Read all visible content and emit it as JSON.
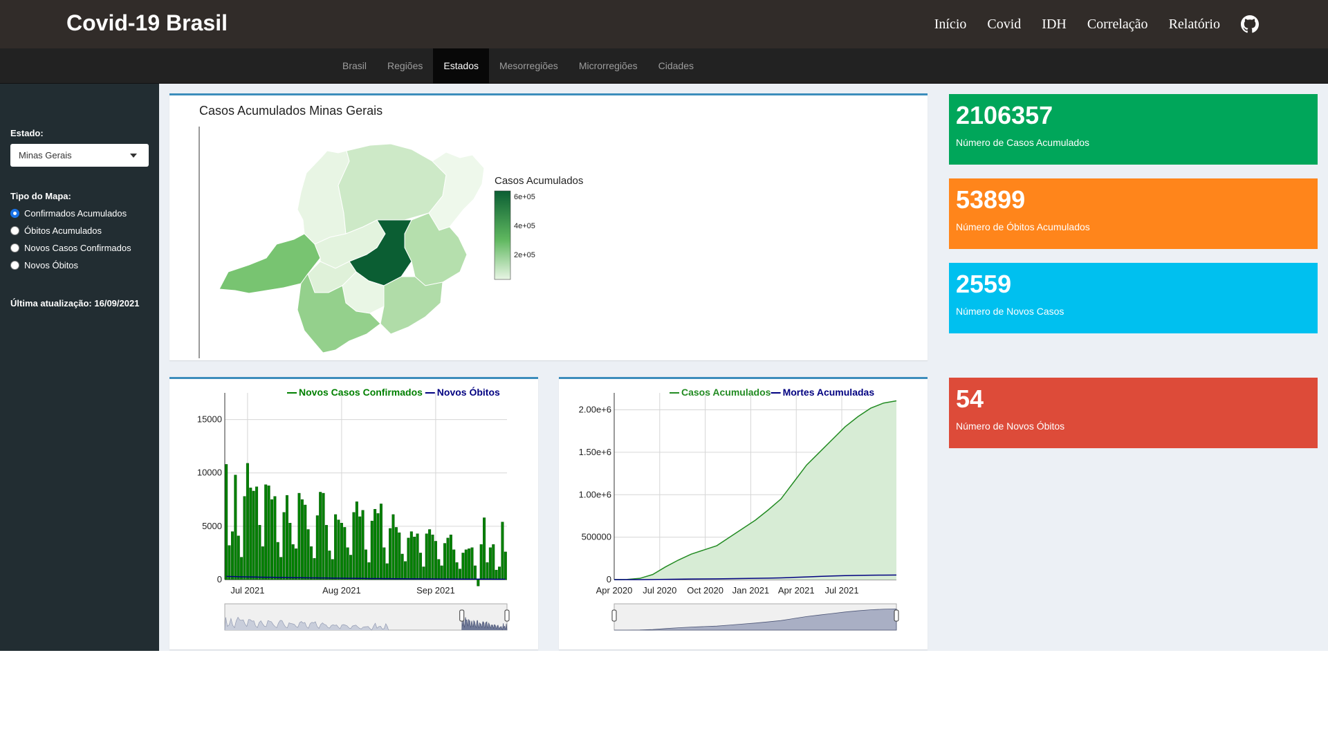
{
  "header": {
    "title": "Covid-19 Brasil",
    "nav": [
      "Início",
      "Covid",
      "IDH",
      "Correlação",
      "Relatório"
    ]
  },
  "subnav": {
    "tabs": [
      "Brasil",
      "Regiões",
      "Estados",
      "Mesorregiões",
      "Microrregiões",
      "Cidades"
    ],
    "active": "Estados"
  },
  "sidebar": {
    "estado_label": "Estado:",
    "estado_value": "Minas Gerais",
    "tipo_label": "Tipo do Mapa:",
    "options": [
      "Confirmados Acumulados",
      "Óbitos Acumulados",
      "Novos Casos Confirmados",
      "Novos Óbitos"
    ],
    "selected": "Confirmados Acumulados",
    "update": "Última atualização: 16/09/2021"
  },
  "map": {
    "title": "Casos Acumulados Minas Gerais",
    "legend_title": "Casos Acumulados",
    "legend_ticks": [
      "6e+05",
      "4e+05",
      "2e+05"
    ]
  },
  "value_boxes": [
    {
      "value": "2106357",
      "label": "Número de Casos Acumulados",
      "color": "#00a65a"
    },
    {
      "value": "53899",
      "label": "Número de Óbitos Acumulados",
      "color": "#ff851b"
    },
    {
      "value": "2559",
      "label": "Número de Novos Casos",
      "color": "#00c0ef"
    },
    {
      "value": "54",
      "label": "Número de Novos Óbitos",
      "color": "#dd4b39"
    }
  ],
  "chart_data": [
    {
      "type": "bar",
      "title": "",
      "legend": [
        "Novos Casos Confirmados",
        "Novos Óbitos"
      ],
      "series_colors": [
        "#008000",
        "#000080"
      ],
      "x_ticks": [
        "Jul 2021",
        "Aug 2021",
        "Sep 2021"
      ],
      "y_ticks": [
        "15000",
        "10000",
        "5000",
        "0"
      ],
      "ylim": [
        0,
        17500
      ],
      "series": [
        {
          "name": "Novos Casos Confirmados",
          "values": [
            10800,
            3200,
            4500,
            9800,
            4100,
            2100,
            7800,
            10900,
            8600,
            8300,
            8700,
            5100,
            3100,
            8900,
            8800,
            7500,
            7800,
            3500,
            2100,
            6300,
            7900,
            5300,
            3300,
            2900,
            8100,
            7500,
            7000,
            4700,
            3100,
            2000,
            6000,
            8200,
            8100,
            5100,
            2700,
            1900,
            6100,
            5600,
            5300,
            4900,
            3000,
            2300,
            6300,
            7300,
            5900,
            6500,
            2800,
            1600,
            5500,
            6600,
            6200,
            7100,
            3000,
            1500,
            4800,
            6100,
            4900,
            4400,
            2400,
            1700,
            3900,
            4500,
            4000,
            4300,
            2500,
            1200,
            4300,
            4700,
            4200,
            3600,
            1900,
            1300,
            3400,
            3900,
            4200,
            2800,
            1600,
            1000,
            2500,
            2800,
            2900,
            3000,
            1300,
            -600,
            3300,
            5800,
            1600,
            3000,
            3300,
            900,
            1200,
            5400,
            2600
          ]
        },
        {
          "name": "Novos Óbitos",
          "values": [
            300,
            290,
            280,
            280,
            270,
            260,
            260,
            250,
            250,
            240,
            240,
            230,
            230,
            220,
            220,
            215,
            210,
            205,
            200,
            200,
            195,
            190,
            185,
            180,
            180,
            175,
            170,
            170,
            165,
            160,
            160,
            155,
            150,
            150,
            145,
            140,
            140,
            135,
            130,
            130,
            125,
            120,
            120,
            115,
            110,
            110,
            105,
            100,
            100,
            100,
            95,
            95,
            90,
            90,
            90,
            85,
            85,
            80,
            80,
            80,
            75,
            75,
            75,
            70,
            70,
            70,
            65,
            65,
            65,
            60,
            60,
            60,
            60,
            55,
            55,
            55,
            55,
            50,
            50,
            50,
            50,
            50,
            45,
            45,
            45,
            45,
            45,
            45,
            40,
            40,
            40,
            40,
            40
          ]
        }
      ]
    },
    {
      "type": "area",
      "title": "",
      "legend": [
        "Casos Acumulados",
        "Mortes Acumuladas"
      ],
      "series_colors": [
        "#228b22",
        "#000080"
      ],
      "x_ticks": [
        "Apr 2020",
        "Jul 2020",
        "Oct 2020",
        "Jan 2021",
        "Apr 2021",
        "Jul 2021"
      ],
      "y_ticks": [
        "2.00e+6",
        "1.50e+6",
        "1.00e+6",
        "500000",
        "0"
      ],
      "ylim": [
        0,
        2200000
      ],
      "series": [
        {
          "name": "Casos Acumulados",
          "values": [
            0,
            2000,
            15000,
            60000,
            150000,
            230000,
            300000,
            350000,
            400000,
            500000,
            600000,
            700000,
            820000,
            950000,
            1150000,
            1350000,
            1500000,
            1650000,
            1800000,
            1920000,
            2020000,
            2080000,
            2106357
          ]
        },
        {
          "name": "Mortes Acumuladas",
          "values": [
            0,
            100,
            500,
            1500,
            3000,
            5000,
            7000,
            8500,
            9500,
            11000,
            13000,
            15000,
            17000,
            20000,
            26000,
            32000,
            38000,
            43000,
            47000,
            50000,
            52000,
            53000,
            53899
          ]
        }
      ]
    }
  ]
}
